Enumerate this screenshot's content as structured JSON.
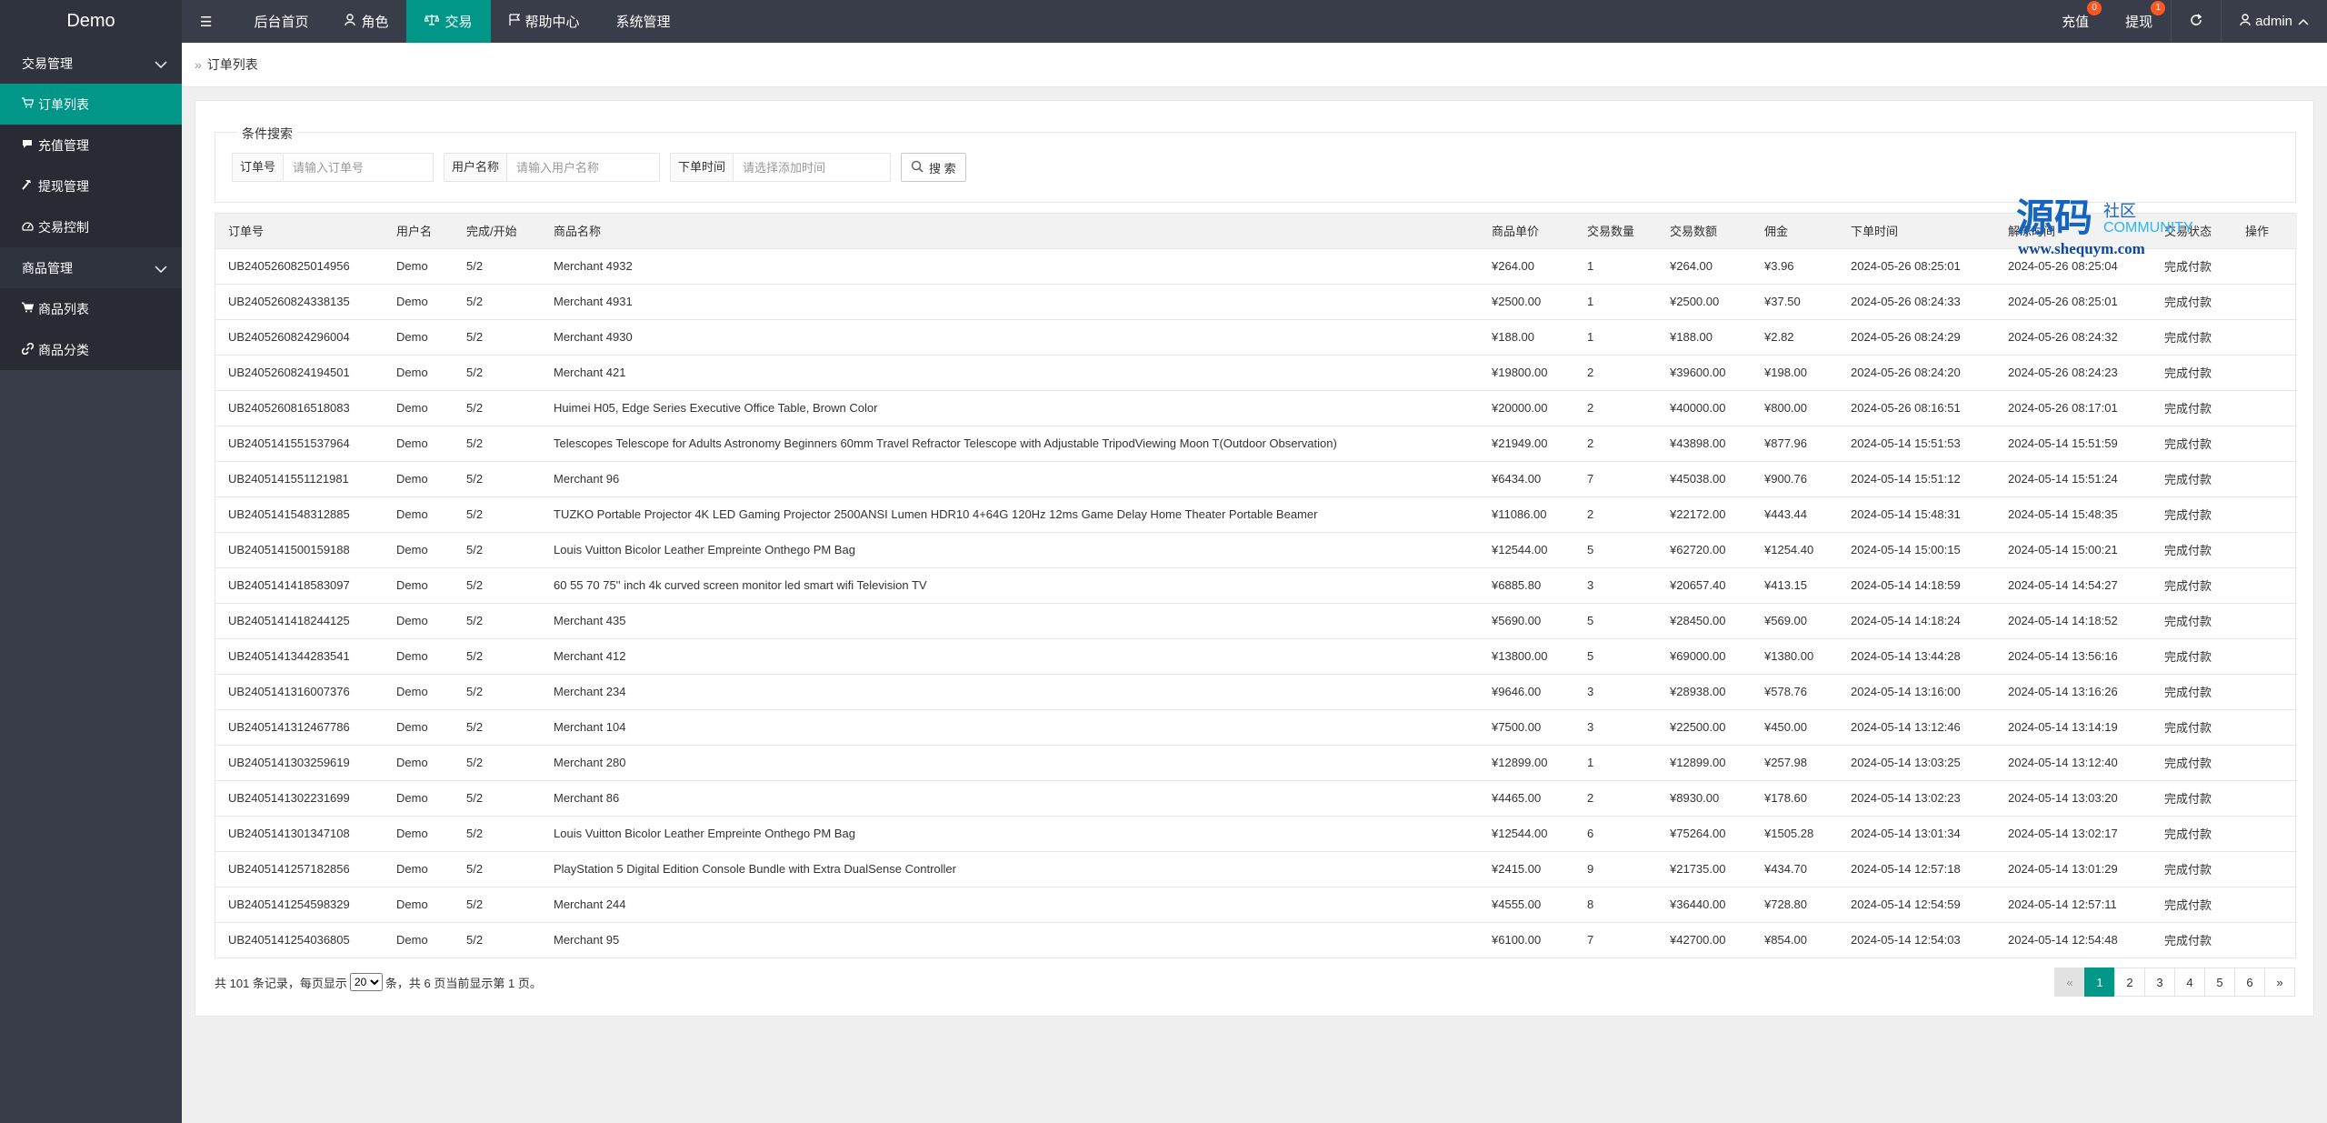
{
  "app": {
    "logo": "Demo"
  },
  "topnav": [
    {
      "icon": "menu-icon",
      "label": ""
    },
    {
      "icon": "",
      "label": "后台首页"
    },
    {
      "icon": "user-icon",
      "label": "角色"
    },
    {
      "icon": "scale-icon",
      "label": "交易"
    },
    {
      "icon": "flag-icon",
      "label": "帮助中心"
    },
    {
      "icon": "",
      "label": "系统管理"
    }
  ],
  "topright": {
    "recharge": {
      "label": "充值",
      "badge": "0"
    },
    "withdraw": {
      "label": "提现",
      "badge": "1"
    },
    "user": "admin"
  },
  "sidebar": {
    "groups": [
      {
        "label": "交易管理",
        "items": [
          {
            "label": "订单列表",
            "icon": "cart-icon",
            "active": true
          },
          {
            "label": "充值管理",
            "icon": "chat-icon",
            "active": false
          },
          {
            "label": "提现管理",
            "icon": "hammer-icon",
            "active": false
          },
          {
            "label": "交易控制",
            "icon": "gauge-icon",
            "active": false
          }
        ]
      },
      {
        "label": "商品管理",
        "items": [
          {
            "label": "商品列表",
            "icon": "cart-icon",
            "active": false
          },
          {
            "label": "商品分类",
            "icon": "link-icon",
            "active": false
          }
        ]
      }
    ]
  },
  "breadcrumb": {
    "current": "订单列表"
  },
  "search": {
    "legend": "条件搜索",
    "order_label": "订单号",
    "order_placeholder": "请输入订单号",
    "user_label": "用户名称",
    "user_placeholder": "请输入用户名称",
    "time_label": "下单时间",
    "time_placeholder": "请选择添加时间",
    "button": "搜 索"
  },
  "table": {
    "headers": [
      "订单号",
      "用户名",
      "完成/开始",
      "商品名称",
      "商品单价",
      "交易数量",
      "交易数额",
      "佣金",
      "下单时间",
      "解冻时间",
      "交易状态",
      "操作"
    ],
    "rows": [
      [
        "UB2405260825014956",
        "Demo",
        "5/2",
        "Merchant 4932",
        "¥264.00",
        "1",
        "¥264.00",
        "¥3.96",
        "2024-05-26 08:25:01",
        "2024-05-26 08:25:04",
        "完成付款",
        ""
      ],
      [
        "UB2405260824338135",
        "Demo",
        "5/2",
        "Merchant 4931",
        "¥2500.00",
        "1",
        "¥2500.00",
        "¥37.50",
        "2024-05-26 08:24:33",
        "2024-05-26 08:25:01",
        "完成付款",
        ""
      ],
      [
        "UB2405260824296004",
        "Demo",
        "5/2",
        "Merchant 4930",
        "¥188.00",
        "1",
        "¥188.00",
        "¥2.82",
        "2024-05-26 08:24:29",
        "2024-05-26 08:24:32",
        "完成付款",
        ""
      ],
      [
        "UB2405260824194501",
        "Demo",
        "5/2",
        "Merchant 421",
        "¥19800.00",
        "2",
        "¥39600.00",
        "¥198.00",
        "2024-05-26 08:24:20",
        "2024-05-26 08:24:23",
        "完成付款",
        ""
      ],
      [
        "UB2405260816518083",
        "Demo",
        "5/2",
        "Huimei H05, Edge Series Executive Office Table, Brown Color",
        "¥20000.00",
        "2",
        "¥40000.00",
        "¥800.00",
        "2024-05-26 08:16:51",
        "2024-05-26 08:17:01",
        "完成付款",
        ""
      ],
      [
        "UB2405141551537964",
        "Demo",
        "5/2",
        "Telescopes Telescope for Adults Astronomy Beginners 60mm Travel Refractor Telescope with Adjustable TripodViewing Moon T(Outdoor Observation)",
        "¥21949.00",
        "2",
        "¥43898.00",
        "¥877.96",
        "2024-05-14 15:51:53",
        "2024-05-14 15:51:59",
        "完成付款",
        ""
      ],
      [
        "UB2405141551121981",
        "Demo",
        "5/2",
        "Merchant 96",
        "¥6434.00",
        "7",
        "¥45038.00",
        "¥900.76",
        "2024-05-14 15:51:12",
        "2024-05-14 15:51:24",
        "完成付款",
        ""
      ],
      [
        "UB2405141548312885",
        "Demo",
        "5/2",
        "TUZKO Portable Projector 4K LED Gaming Projector 2500ANSI Lumen HDR10 4+64G 120Hz 12ms Game Delay Home Theater Portable Beamer",
        "¥11086.00",
        "2",
        "¥22172.00",
        "¥443.44",
        "2024-05-14 15:48:31",
        "2024-05-14 15:48:35",
        "完成付款",
        ""
      ],
      [
        "UB2405141500159188",
        "Demo",
        "5/2",
        "Louis Vuitton Bicolor Leather Empreinte Onthego PM Bag",
        "¥12544.00",
        "5",
        "¥62720.00",
        "¥1254.40",
        "2024-05-14 15:00:15",
        "2024-05-14 15:00:21",
        "完成付款",
        ""
      ],
      [
        "UB2405141418583097",
        "Demo",
        "5/2",
        "60 55 70 75'' inch 4k curved screen monitor led smart wifi Television TV",
        "¥6885.80",
        "3",
        "¥20657.40",
        "¥413.15",
        "2024-05-14 14:18:59",
        "2024-05-14 14:54:27",
        "完成付款",
        ""
      ],
      [
        "UB2405141418244125",
        "Demo",
        "5/2",
        "Merchant 435",
        "¥5690.00",
        "5",
        "¥28450.00",
        "¥569.00",
        "2024-05-14 14:18:24",
        "2024-05-14 14:18:52",
        "完成付款",
        ""
      ],
      [
        "UB2405141344283541",
        "Demo",
        "5/2",
        "Merchant 412",
        "¥13800.00",
        "5",
        "¥69000.00",
        "¥1380.00",
        "2024-05-14 13:44:28",
        "2024-05-14 13:56:16",
        "完成付款",
        ""
      ],
      [
        "UB2405141316007376",
        "Demo",
        "5/2",
        "Merchant 234",
        "¥9646.00",
        "3",
        "¥28938.00",
        "¥578.76",
        "2024-05-14 13:16:00",
        "2024-05-14 13:16:26",
        "完成付款",
        ""
      ],
      [
        "UB2405141312467786",
        "Demo",
        "5/2",
        "Merchant 104",
        "¥7500.00",
        "3",
        "¥22500.00",
        "¥450.00",
        "2024-05-14 13:12:46",
        "2024-05-14 13:14:19",
        "完成付款",
        ""
      ],
      [
        "UB2405141303259619",
        "Demo",
        "5/2",
        "Merchant 280",
        "¥12899.00",
        "1",
        "¥12899.00",
        "¥257.98",
        "2024-05-14 13:03:25",
        "2024-05-14 13:12:40",
        "完成付款",
        ""
      ],
      [
        "UB2405141302231699",
        "Demo",
        "5/2",
        "Merchant 86",
        "¥4465.00",
        "2",
        "¥8930.00",
        "¥178.60",
        "2024-05-14 13:02:23",
        "2024-05-14 13:03:20",
        "完成付款",
        ""
      ],
      [
        "UB2405141301347108",
        "Demo",
        "5/2",
        "Louis Vuitton Bicolor Leather Empreinte Onthego PM Bag",
        "¥12544.00",
        "6",
        "¥75264.00",
        "¥1505.28",
        "2024-05-14 13:01:34",
        "2024-05-14 13:02:17",
        "完成付款",
        ""
      ],
      [
        "UB2405141257182856",
        "Demo",
        "5/2",
        "PlayStation 5 Digital Edition Console Bundle with Extra DualSense Controller",
        "¥2415.00",
        "9",
        "¥21735.00",
        "¥434.70",
        "2024-05-14 12:57:18",
        "2024-05-14 13:01:29",
        "完成付款",
        ""
      ],
      [
        "UB2405141254598329",
        "Demo",
        "5/2",
        "Merchant 244",
        "¥4555.00",
        "8",
        "¥36440.00",
        "¥728.80",
        "2024-05-14 12:54:59",
        "2024-05-14 12:57:11",
        "完成付款",
        ""
      ],
      [
        "UB2405141254036805",
        "Demo",
        "5/2",
        "Merchant 95",
        "¥6100.00",
        "7",
        "¥42700.00",
        "¥854.00",
        "2024-05-14 12:54:03",
        "2024-05-14 12:54:48",
        "完成付款",
        ""
      ]
    ]
  },
  "footer": {
    "prefix": "共 101 条记录，每页显示",
    "page_size": "20",
    "suffix": "条，共 6 页当前显示第 1 页。"
  },
  "pagination": {
    "prev": "«",
    "pages": [
      "1",
      "2",
      "3",
      "4",
      "5",
      "6"
    ],
    "current": "1",
    "next": "»"
  },
  "watermark": {
    "big": "源码",
    "small": "社区",
    "en": "COMMUNITY",
    "url": "www.shequym.com"
  },
  "colors": {
    "accent": "#009688",
    "topbar": "#393d49",
    "badge": "#ff5722"
  }
}
